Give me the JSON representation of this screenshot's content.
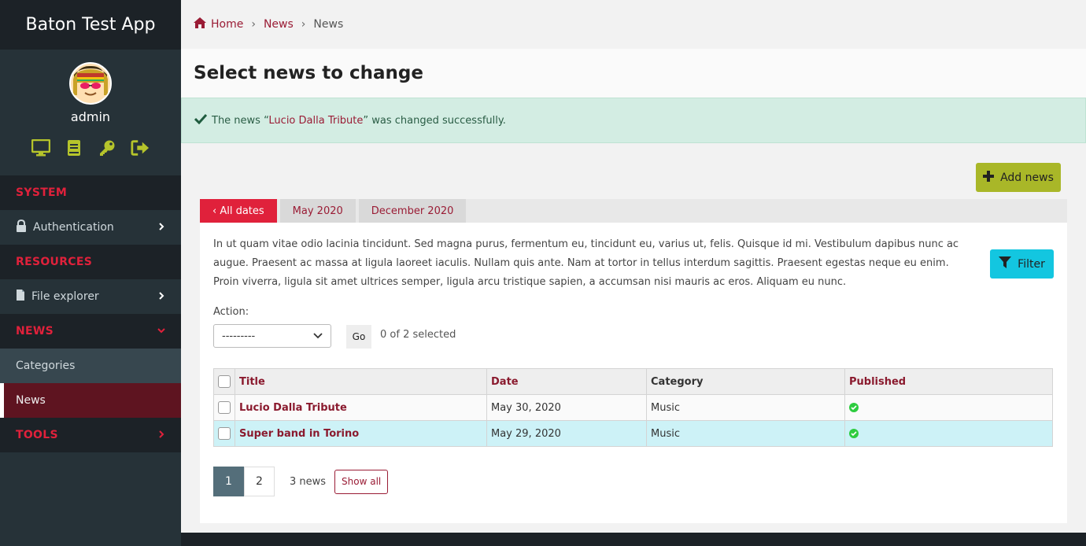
{
  "sidebar": {
    "brand": "Baton Test App",
    "username": "admin",
    "icons": [
      "monitor-icon",
      "book-icon",
      "key-icon",
      "logout-icon"
    ],
    "sections": {
      "system": "SYSTEM",
      "authentication": "Authentication",
      "resources": "RESOURCES",
      "file_explorer": "File explorer",
      "news": "NEWS",
      "categories": "Categories",
      "news_item": "News",
      "tools": "TOOLS"
    }
  },
  "breadcrumb": {
    "home": "Home",
    "section": "News",
    "current": "News",
    "separator": "›"
  },
  "page_title": "Select news to change",
  "alert": {
    "prefix": "The news “",
    "link": "Lucio Dalla Tribute",
    "suffix": "” was changed successfully."
  },
  "add_button": "Add news",
  "date_tabs": [
    "‹ All dates",
    "May 2020",
    "December 2020"
  ],
  "description": "In ut quam vitae odio lacinia tincidunt. Sed magna purus, fermentum eu, tincidunt eu, varius ut, felis. Quisque id mi. Vestibulum dapibus nunc ac augue. Praesent ac massa at ligula laoreet iaculis. Nullam quis ante. Nam at tortor in tellus interdum sagittis. Praesent egestas neque eu enim. Proin viverra, ligula sit amet ultrices semper, ligula arcu tristique sapien, a accumsan nisi mauris ac eros. Aliquam eu nunc.",
  "filter_button": "Filter",
  "action": {
    "label": "Action:",
    "selected": "---------",
    "go": "Go",
    "counter": "0 of 2 selected"
  },
  "table": {
    "headers": {
      "title": "Title",
      "date": "Date",
      "category": "Category",
      "published": "Published"
    },
    "rows": [
      {
        "title": "Lucio Dalla Tribute",
        "date": "May 30, 2020",
        "category": "Music"
      },
      {
        "title": "Super band in Torino",
        "date": "May 29, 2020",
        "category": "Music"
      }
    ]
  },
  "pagination": {
    "pages": [
      "1",
      "2"
    ],
    "count": "3 news",
    "show_all": "Show all"
  },
  "colors": {
    "accent": "#e0213b",
    "sidebar": "#263238",
    "add": "#a9b728",
    "filter": "#13c6e0"
  }
}
